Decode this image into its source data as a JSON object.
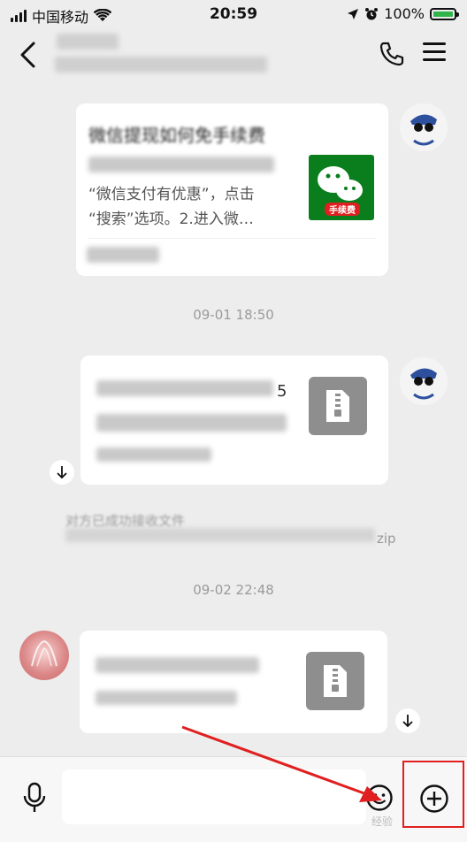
{
  "status": {
    "carrier": "中国移动",
    "time": "20:59",
    "battery_pct": "100%",
    "battery_level": 1.0
  },
  "nav": {
    "icons": [
      "back-icon",
      "phone-icon",
      "menu-icon"
    ]
  },
  "messages": {
    "link_card": {
      "title": "微信提现如何免手续费",
      "snippet_line2": "“微信支付有优惠”，点击",
      "snippet_line3": "“搜索”选项。2.进入微…",
      "thumb_label": "手续费"
    },
    "timestamp1": "09-01 18:50",
    "file_card1": {
      "line1_tail": "5"
    },
    "system_notice": {
      "line1": "对方已成功接收文件",
      "line2_tail": "zip"
    },
    "timestamp2": "09-02 22:48"
  },
  "input": {
    "placeholder": ""
  },
  "watermark": "经验"
}
